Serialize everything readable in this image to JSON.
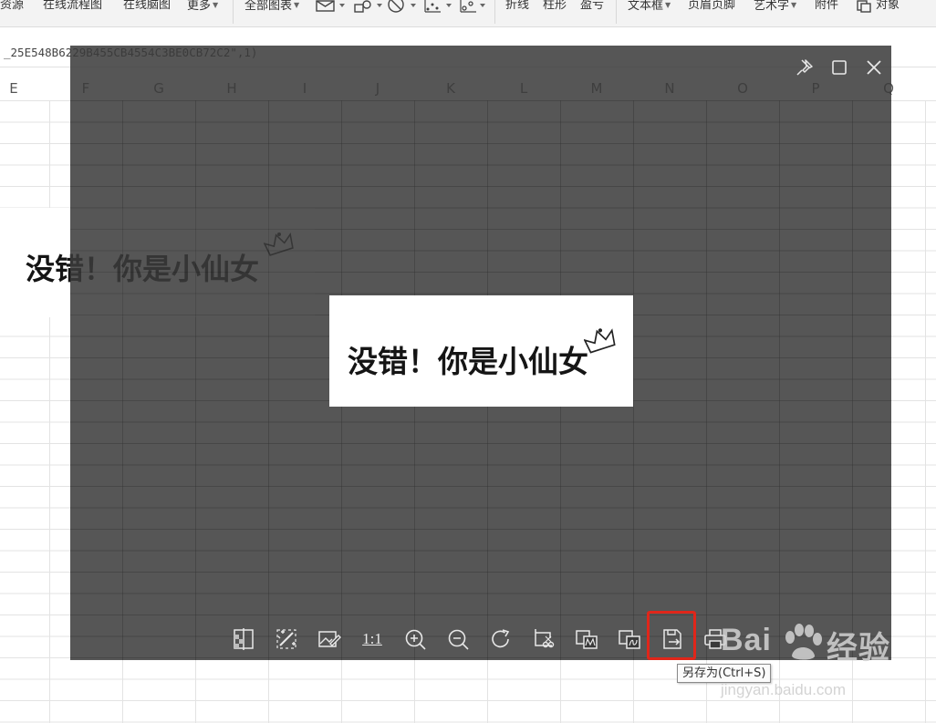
{
  "ribbon": {
    "items": [
      {
        "label": "资源",
        "caret": false
      },
      {
        "label": "在线流程图",
        "caret": false
      },
      {
        "label": "在线脑图",
        "caret": false
      },
      {
        "label": "更多",
        "caret": true
      },
      {
        "label": "全部图表",
        "caret": true
      },
      {
        "label": "折线",
        "caret": false
      },
      {
        "label": "柱形",
        "caret": false
      },
      {
        "label": "盈亏",
        "caret": false
      },
      {
        "label": "文本框",
        "caret": true
      },
      {
        "label": "页眉页脚",
        "caret": false
      },
      {
        "label": "艺术字",
        "caret": true
      },
      {
        "label": "附件",
        "caret": false
      },
      {
        "label": "对象",
        "caret": false
      }
    ],
    "icons": [
      "mail-icon",
      "shapes-icon",
      "clock-icon",
      "scatter-icon",
      "chart-icon",
      "object-icon"
    ]
  },
  "formula_bar": {
    "text": "_25E548B6229B455CB4554C3BE0CB72C2\",1)"
  },
  "columns": [
    "E",
    "F",
    "G",
    "H",
    "I",
    "J",
    "K",
    "L",
    "M",
    "N",
    "O",
    "P",
    "Q"
  ],
  "cell_image": {
    "text": "没错！你是小仙女"
  },
  "viewer": {
    "controls": [
      "pin-icon",
      "maximize-icon",
      "close-icon"
    ],
    "preview_text": "没错！你是小仙女",
    "toolbar": {
      "actual_size_label": "1:1",
      "buttons": [
        "compare-icon",
        "magic-wand-icon",
        "edit-image-icon",
        "actual-size",
        "zoom-in-icon",
        "zoom-out-icon",
        "rotate-icon",
        "crop-icon",
        "image-convert-icon",
        "image-to-pdf-icon",
        "save-as-icon",
        "print-icon"
      ]
    },
    "tooltip": "另存为(Ctrl+S)"
  },
  "watermark": {
    "logo_left": "Bai",
    "logo_right": "经验",
    "url": "jingyan.baidu.com"
  },
  "colors": {
    "viewer_bg": "#3a3a3a",
    "highlight": "#e0261a"
  }
}
